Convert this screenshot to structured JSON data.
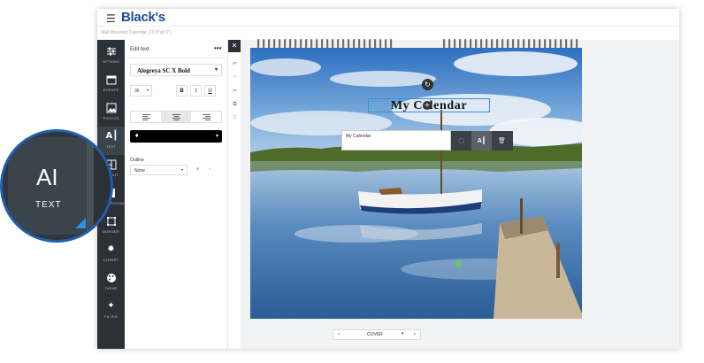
{
  "header": {
    "brand": "Black's",
    "product_title": "Wall Mounted Calendar (10.8\"x8.5\")"
  },
  "sidebar": {
    "items": [
      {
        "label": "OPTIONS",
        "icon": "sliders-icon"
      },
      {
        "label": "EVENTS",
        "icon": "calendar-icon"
      },
      {
        "label": "PHOTOS",
        "icon": "image-icon"
      },
      {
        "label": "TEXT",
        "icon": "text-cursor-icon"
      },
      {
        "label": "LAYOUT",
        "icon": "layout-icon"
      },
      {
        "label": "BACKGROUND",
        "icon": "background-icon"
      },
      {
        "label": "BORDER",
        "icon": "border-icon"
      },
      {
        "label": "CLIPART",
        "icon": "clipart-icon"
      },
      {
        "label": "THEME",
        "icon": "palette-icon"
      },
      {
        "label": "FILTER",
        "icon": "sparkle-icon"
      }
    ],
    "active": "TEXT"
  },
  "edit_panel": {
    "title": "Edit text",
    "more": "•••",
    "font": "Alegreya SC X Bold",
    "font_size": "36",
    "bold": "B",
    "italic": "I",
    "underline": "U",
    "text_color": "#000000",
    "outline_label": "Outline",
    "outline_value": "None"
  },
  "canvas": {
    "calendar_title": "My Calendar",
    "text_input_value": "My Calendar",
    "page_label": "COVER"
  },
  "zoom_callout": {
    "label": "TEXT"
  },
  "colors": {
    "brand": "#1b4c97",
    "sidebar": "#2b3137",
    "selection": "#3a8fd4",
    "accent": "#2f8ee0"
  }
}
